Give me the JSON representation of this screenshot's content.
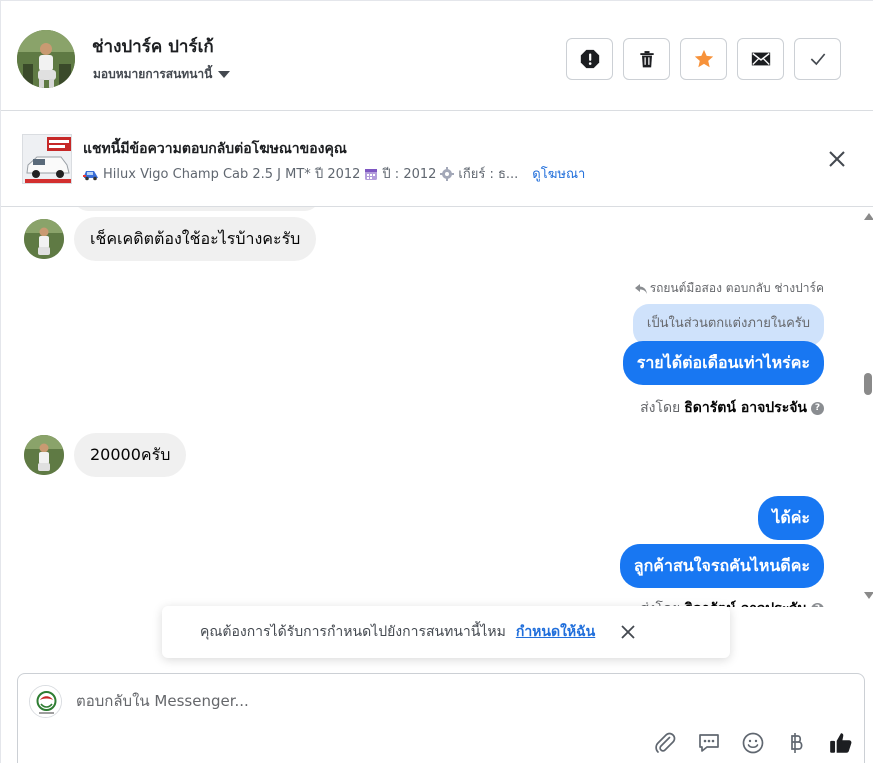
{
  "header": {
    "contact_name": "ช่างปาร์ค ปาร์เก้",
    "assign_label": "มอบหมายการสนทนานี้",
    "actions": [
      "mark-spam",
      "delete",
      "star",
      "mark-unread",
      "mark-done"
    ]
  },
  "ad_banner": {
    "title": "แชทนี้มีข้อความตอบกลับต่อโฆษณาของคุณ",
    "subtitle": "Hilux Vigo Champ Cab 2.5 J MT* ปี 2012",
    "year_text": "ปี : 2012",
    "gear_text": "เกียร์ : ธ...",
    "link": "ดูโฆษณา"
  },
  "messages": [
    {
      "direction": "in",
      "text": "เช็คเคดิตต้องใช้อะไรบ้างคะรับ"
    },
    {
      "direction": "out",
      "reply_note": "รถยนต์มือสอง ตอบกลับ ช่างปาร์ค",
      "quoted": "เป็นในส่วนตกแต่งภายในครับ",
      "text": "รายได้ต่อเดือนเท่าไหร่คะ",
      "sent_by_label": "ส่งโดย",
      "sender": "ธิดารัตน์ อาจประจัน"
    },
    {
      "direction": "in",
      "text": "20000ครับ"
    },
    {
      "direction": "out",
      "text": "ได้ค่ะ"
    },
    {
      "direction": "out",
      "text": "ลูกค้าสนใจรถคันไหนดีคะ",
      "sent_by_label": "ส่งโดย",
      "sender": "ธิดารัตน์ อาจประจัน"
    }
  ],
  "toast": {
    "text": "คุณต้องการได้รับการกำหนดไปยังการสนทนานี้ไหม",
    "link": "กำหนดให้ฉัน"
  },
  "composer": {
    "placeholder": "ตอบกลับใน Messenger...",
    "tools": [
      "attach-icon",
      "saved-reply-icon",
      "emoji-icon",
      "baht-icon",
      "like-icon"
    ]
  },
  "colors": {
    "accent": "#1877f2",
    "star": "#f7923a",
    "link": "#216fdb",
    "quote_bg": "#cfe2fb",
    "incoming_bg": "#f0f0f0"
  }
}
